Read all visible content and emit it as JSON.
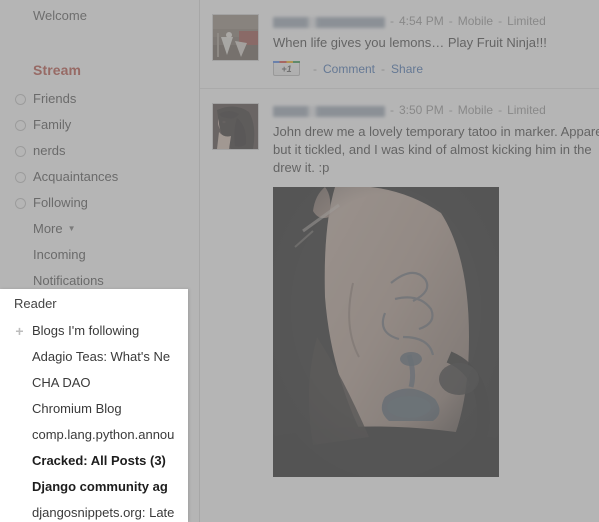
{
  "sidebar": {
    "welcome_label": "Welcome",
    "stream_heading": "Stream",
    "circles": [
      {
        "label": "Friends",
        "icon": "circle-outline-icon"
      },
      {
        "label": "Family",
        "icon": "circle-outline-icon"
      },
      {
        "label": "nerds",
        "icon": "circle-outline-icon"
      },
      {
        "label": "Acquaintances",
        "icon": "circle-outline-icon"
      },
      {
        "label": "Following",
        "icon": "circle-outline-icon"
      }
    ],
    "more_label": "More",
    "more_caret": "▼",
    "incoming_label": "Incoming",
    "notifications_label": "Notifications"
  },
  "reader": {
    "heading": "Reader",
    "add_icon": "plus-icon",
    "blogs_following_label": "Blogs I'm following",
    "feeds": [
      {
        "label": "Adagio Teas: What's Ne",
        "unread": false
      },
      {
        "label": "CHA DAO",
        "unread": false
      },
      {
        "label": "Chromium Blog",
        "unread": false
      },
      {
        "label": "comp.lang.python.annou",
        "unread": false
      },
      {
        "label": "Cracked: All Posts (3)",
        "unread": true
      },
      {
        "label": "Django community ag",
        "unread": true
      },
      {
        "label": "djangosnippets.org: Late",
        "unread": false
      }
    ]
  },
  "stream": {
    "posts": [
      {
        "author": "",
        "author_redacted": true,
        "time": "4:54 PM",
        "source": "Mobile",
        "audience": "Limited",
        "separator": "-",
        "text": "When life gives you lemons… Play Fruit Ninja!!!",
        "avatar_icon": "avatar-photo-market",
        "actions": {
          "plusone_label": "+1",
          "comment_label": "Comment",
          "share_label": "Share",
          "separator": "-"
        },
        "photo": null
      },
      {
        "author": "",
        "author_redacted": true,
        "time": "3:50 PM",
        "source": "Mobile",
        "audience": "Limited",
        "separator": "-",
        "text_lines": [
          "John drew me a lovely temporary tatoo in marker. Appare",
          "but it tickled, and I was kind of almost kicking him in the",
          "drew it. :p"
        ],
        "avatar_icon": "avatar-photo-portrait",
        "photo": {
          "icon": "tattoo-photo",
          "alt": "marker tattoo on skin"
        }
      }
    ]
  },
  "colors": {
    "stream_heading": "#b03b2e",
    "link": "#2b5fa8",
    "dim_overlay": "#878787",
    "panel_background": "#ffffff",
    "body_text": "#2b2b2b"
  }
}
